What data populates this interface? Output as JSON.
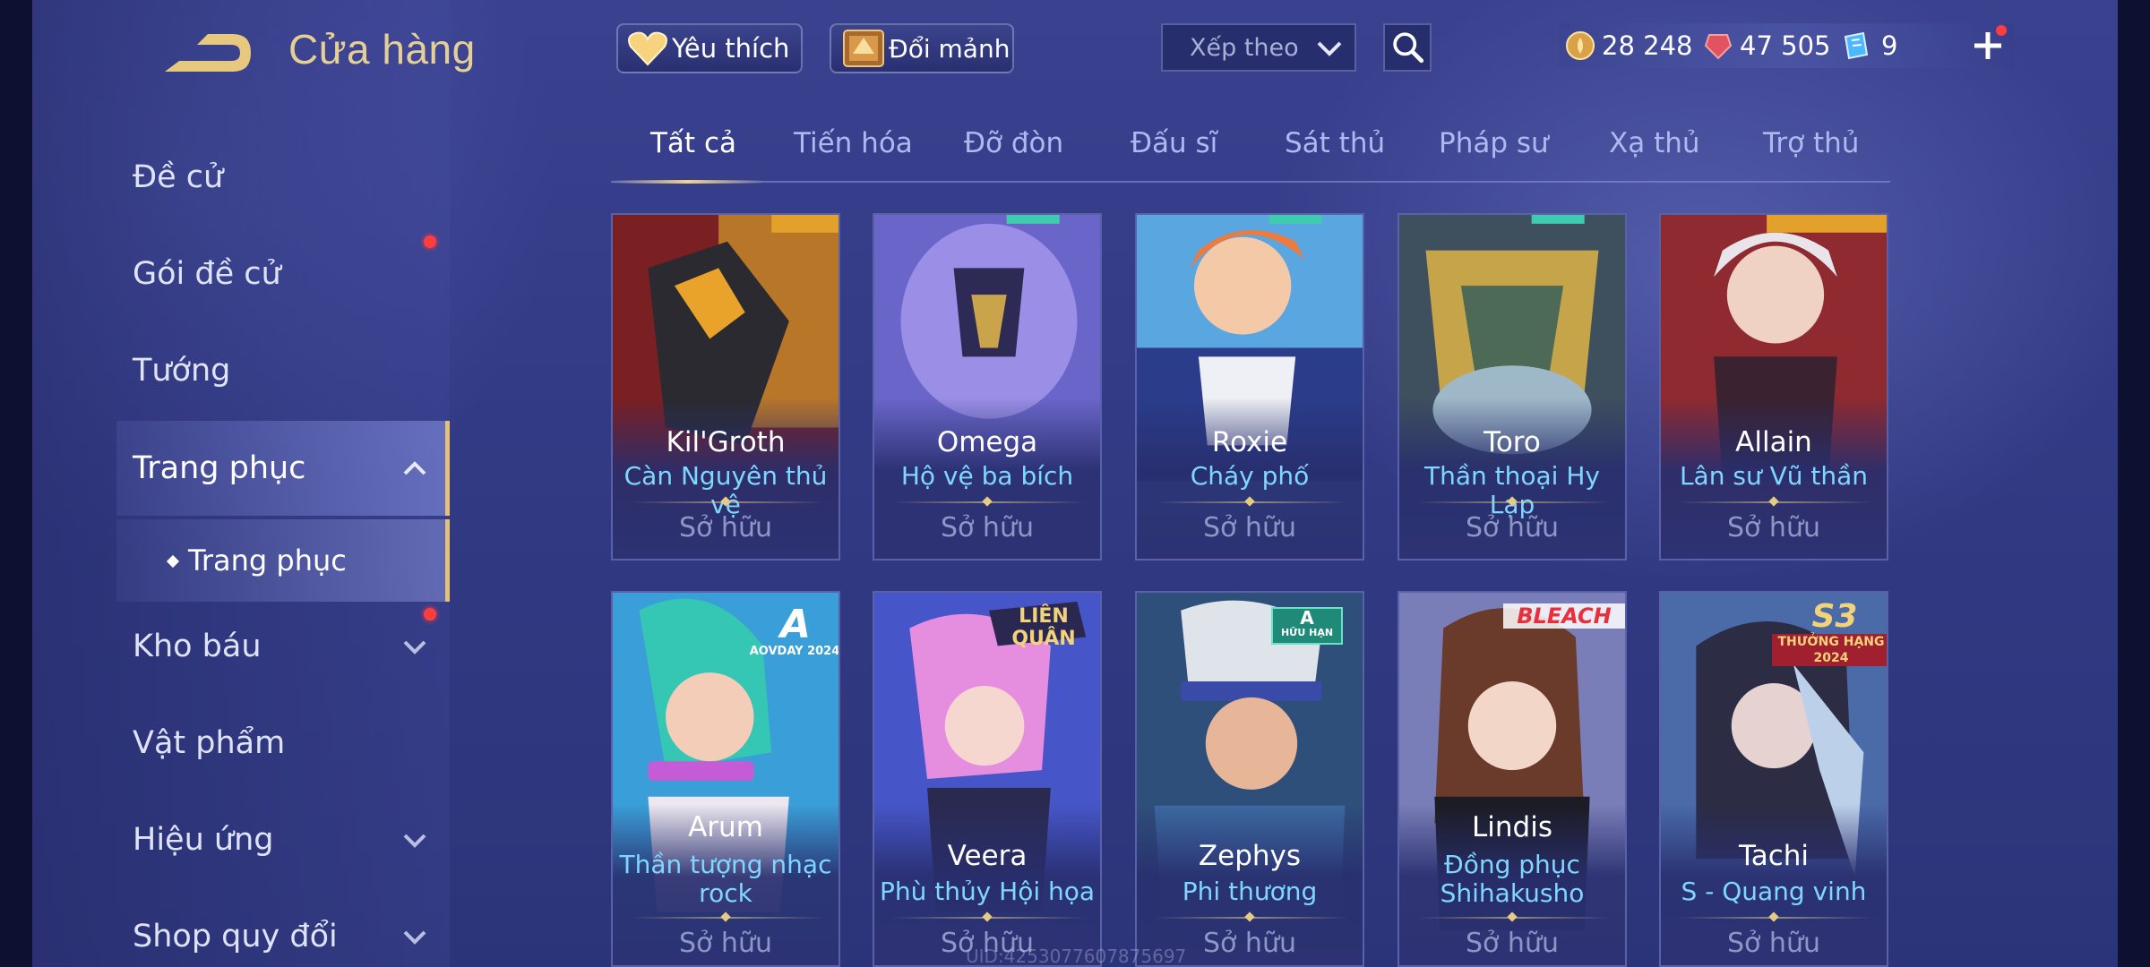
{
  "header": {
    "title": "Cửa hàng"
  },
  "sidebar": {
    "items": [
      {
        "label": "Đề cử"
      },
      {
        "label": "Gói đề cử"
      },
      {
        "label": "Tướng"
      },
      {
        "label": "Trang phục"
      },
      {
        "label": "Trang phục"
      },
      {
        "label": "Kho báu"
      },
      {
        "label": "Vật phẩm"
      },
      {
        "label": "Hiệu ứng"
      },
      {
        "label": "Shop quy đổi"
      }
    ]
  },
  "topbar": {
    "favorites_label": "Yêu thích",
    "exchange_label": "Đổi mảnh",
    "sort_placeholder": "Xếp theo"
  },
  "currency": {
    "gold": "28 248",
    "gems": "47 505",
    "vouchers": "9"
  },
  "tabs": [
    "Tất cả",
    "Tiến hóa",
    "Đỡ đòn",
    "Đấu sĩ",
    "Sát thủ",
    "Pháp sư",
    "Xạ thủ",
    "Trợ thủ"
  ],
  "cards": [
    {
      "hero": "Kil'Groth",
      "skin": "Càn Nguyên thủ vệ",
      "status": "Sở hữu"
    },
    {
      "hero": "Omega",
      "skin": "Hộ vệ ba bích",
      "status": "Sở hữu"
    },
    {
      "hero": "Roxie",
      "skin": "Cháy phố",
      "status": "Sở hữu"
    },
    {
      "hero": "Toro",
      "skin": "Thần thoại Hy Lạp",
      "status": "Sở hữu"
    },
    {
      "hero": "Allain",
      "skin": "Lân sư Vũ thần",
      "status": "Sở hữu"
    },
    {
      "hero": "Arum",
      "skin": "Thần tượng nhạc rock",
      "status": "Sở hữu",
      "badge": "AOVDAY 2024"
    },
    {
      "hero": "Veera",
      "skin": "Phù thủy Hội họa",
      "status": "Sở hữu",
      "badge": "LIÊN QUÂN"
    },
    {
      "hero": "Zephys",
      "skin": "Phi thương",
      "status": "Sở hữu",
      "badge": "HỮU HẠN"
    },
    {
      "hero": "Lindis",
      "skin": "Đồng phục Shihakusho",
      "status": "Sở hữu",
      "badge": "BLEACH"
    },
    {
      "hero": "Tachi",
      "skin": "S - Quang vinh",
      "status": "Sở hữu",
      "badge": "THƯỞNG HẠNG 2024"
    }
  ],
  "footer": {
    "uid": "UID:4253077607875697"
  },
  "colors": {
    "accent_gold": "#e6cf95",
    "skin_name": "#7fd6ff",
    "active_bar": "#e2c27a",
    "notify_dot": "#ff3d3d"
  }
}
